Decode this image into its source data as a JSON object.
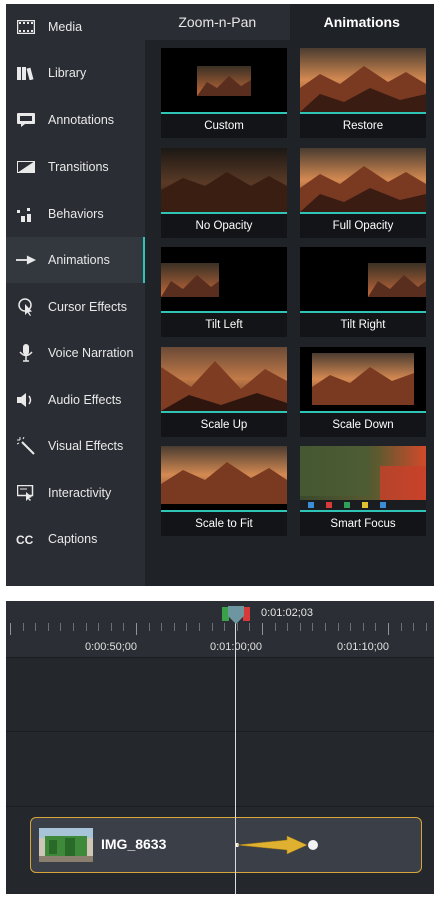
{
  "sidebar": {
    "items": [
      {
        "label": "Media",
        "icon": "film-strip-icon"
      },
      {
        "label": "Library",
        "icon": "books-icon"
      },
      {
        "label": "Annotations",
        "icon": "speech-bubble-icon"
      },
      {
        "label": "Transitions",
        "icon": "transition-icon"
      },
      {
        "label": "Behaviors",
        "icon": "behaviors-icon"
      },
      {
        "label": "Animations",
        "icon": "arrow-right-icon"
      },
      {
        "label": "Cursor Effects",
        "icon": "cursor-icon"
      },
      {
        "label": "Voice Narration",
        "icon": "microphone-icon"
      },
      {
        "label": "Audio Effects",
        "icon": "speaker-icon"
      },
      {
        "label": "Visual Effects",
        "icon": "magic-wand-icon"
      },
      {
        "label": "Interactivity",
        "icon": "interactivity-icon"
      },
      {
        "label": "Captions",
        "icon": "cc-icon"
      }
    ],
    "active_index": 5
  },
  "tabs": [
    {
      "label": "Zoom-n-Pan"
    },
    {
      "label": "Animations"
    }
  ],
  "active_tab": "Animations",
  "tiles": [
    {
      "label": "Custom"
    },
    {
      "label": "Restore"
    },
    {
      "label": "No Opacity"
    },
    {
      "label": "Full Opacity"
    },
    {
      "label": "Tilt Left"
    },
    {
      "label": "Tilt Right"
    },
    {
      "label": "Scale Up"
    },
    {
      "label": "Scale Down"
    },
    {
      "label": "Scale to Fit"
    },
    {
      "label": "Smart Focus"
    }
  ],
  "timeline": {
    "time_labels": [
      "0:00:50;00",
      "0:01:00;00",
      "0:01:10;00"
    ],
    "playhead_time": "0:01:02;03",
    "clip_name": "IMG_8633"
  },
  "colors": {
    "accent": "#2ec4b6",
    "clip_border": "#d7a63a",
    "animation_arrow": "#e0b030"
  }
}
